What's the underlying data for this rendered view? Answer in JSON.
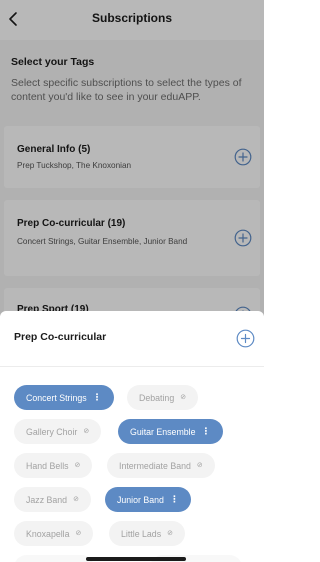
{
  "header": {
    "title": "Subscriptions",
    "back_icon": "chevron-left-icon"
  },
  "intro": {
    "title": "Select your Tags",
    "description": "Select specific subscriptions to select the types of content you'd like to see in your eduAPP."
  },
  "cards": [
    {
      "title": "General Info (5)",
      "subtitle": "Prep Tuckshop, The Knoxonian",
      "icon": "plus-circle-icon"
    },
    {
      "title": "Prep Co-curricular (19)",
      "subtitle": "Concert Strings, Guitar Ensemble, Junior Band",
      "icon": "plus-circle-icon"
    },
    {
      "title": "Prep Sport (19)",
      "subtitle": "",
      "icon": "plus-circle-icon"
    }
  ],
  "sheet": {
    "title": "Prep Co-curricular",
    "add_icon": "plus-circle-icon",
    "tags": [
      {
        "label": "Concert Strings",
        "selected": true,
        "icon": "more-vertical-icon"
      },
      {
        "label": "Debating",
        "selected": false,
        "icon": "x-circle-icon"
      },
      {
        "label": "Gallery Choir",
        "selected": false,
        "icon": "x-circle-icon"
      },
      {
        "label": "Guitar Ensemble",
        "selected": true,
        "icon": "more-vertical-icon"
      },
      {
        "label": "Hand Bells",
        "selected": false,
        "icon": "x-circle-icon"
      },
      {
        "label": "Intermediate Band",
        "selected": false,
        "icon": "x-circle-icon"
      },
      {
        "label": "Jazz Band",
        "selected": false,
        "icon": "x-circle-icon"
      },
      {
        "label": "Junior Band",
        "selected": true,
        "icon": "more-vertical-icon"
      },
      {
        "label": "Knoxapella",
        "selected": false,
        "icon": "x-circle-icon"
      },
      {
        "label": "Little Lads",
        "selected": false,
        "icon": "x-circle-icon"
      }
    ]
  },
  "colors": {
    "accent": "#5d8ac4",
    "chip_unselected_bg": "#f3f3f3",
    "chip_unselected_text": "#a2a2a2"
  }
}
